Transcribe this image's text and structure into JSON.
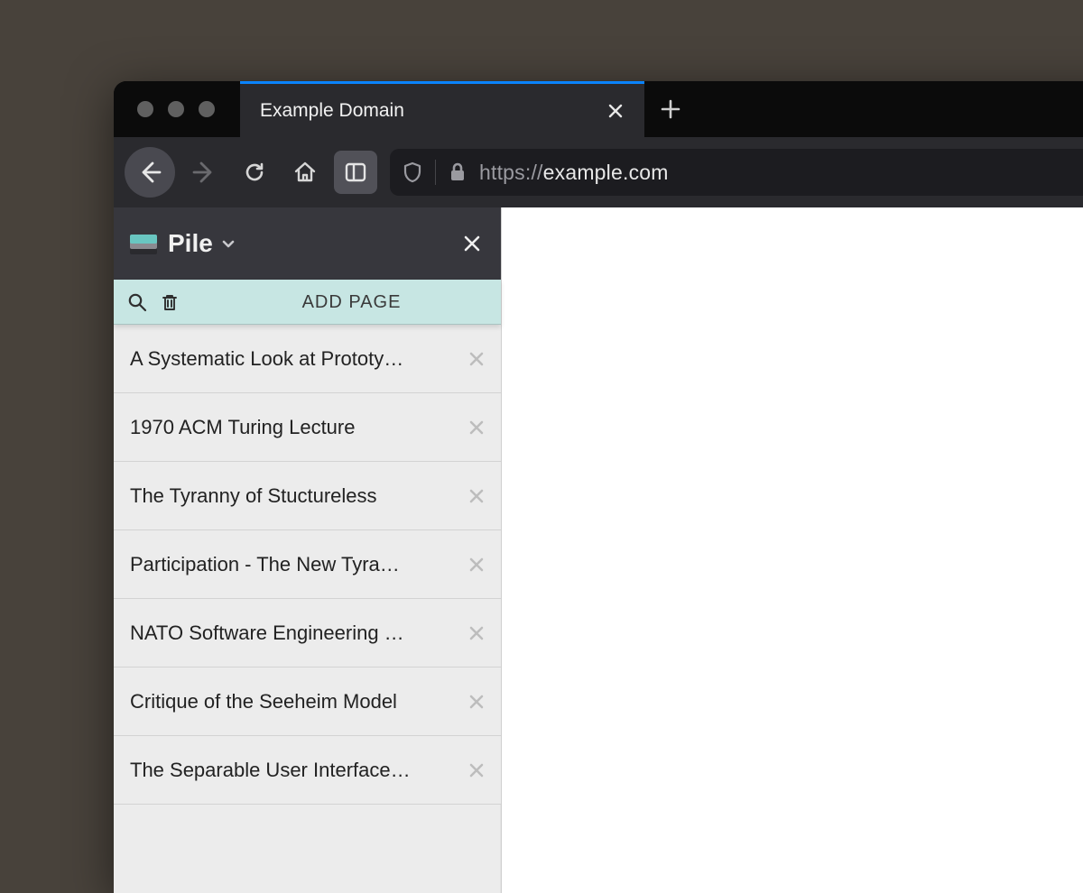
{
  "browser": {
    "tab_title": "Example Domain",
    "url_scheme": "https://",
    "url_host": "example.com",
    "url_path": ""
  },
  "sidebar": {
    "title": "Pile",
    "add_page_label": "ADD PAGE",
    "items": [
      {
        "title": "A Systematic Look at Prototy…"
      },
      {
        "title": "1970 ACM Turing Lecture"
      },
      {
        "title": "The Tyranny of Stuctureless"
      },
      {
        "title": "Participation - The New Tyra…"
      },
      {
        "title": "NATO Software Engineering …"
      },
      {
        "title": "Critique of the Seeheim Model"
      },
      {
        "title": "The Separable User Interface…"
      }
    ]
  }
}
